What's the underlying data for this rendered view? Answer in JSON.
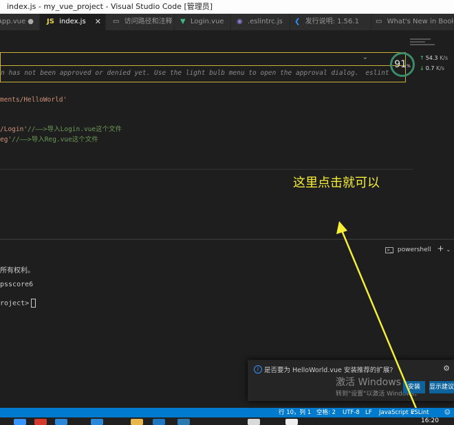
{
  "window": {
    "title": "index.js - my_vue_project - Visual Studio Code [管理员]"
  },
  "tabs": [
    {
      "icon_text": "",
      "label": "App.vue",
      "modified": true
    },
    {
      "icon_text": "JS",
      "label": "index.js",
      "active": true
    },
    {
      "icon_text": "",
      "label": "访问路径和注释"
    },
    {
      "icon_text": "",
      "label": "Login.vue"
    },
    {
      "icon_text": "",
      "label": ".eslintrc.js"
    },
    {
      "icon_text": "",
      "label": "发行说明: 1.56.1"
    },
    {
      "icon_text": "",
      "label": "What's New in Bookm"
    }
  ],
  "hover": {
    "message": "n has not been approved or denied yet. Use the light bulb menu to open the approval dialog.",
    "source": "eslint"
  },
  "editor": {
    "line1": "ments/HelloWorld'",
    "line2_str": "/Login'",
    "line2_cmt": "//——>导入Login.vue这个文件",
    "line3_str": "eg'",
    "line3_cmt": "//——>导入Reg.vue这个文件"
  },
  "annotation": "这里点击就可以",
  "widget": {
    "percent": "91",
    "percent_unit": "%",
    "upload": "54.3",
    "upload_unit": "K/s",
    "download": "0.7",
    "download_unit": "K/s"
  },
  "terminal": {
    "shell": "powershell",
    "line1": "所有权利。",
    "line2": "psscore6",
    "line3": "roject>"
  },
  "notification": {
    "text": "是否要为 HelloWorld.vue 安装推荐的扩展?",
    "install_label": "安装",
    "show_label": "显示建议"
  },
  "watermark": {
    "line1": "激活 Windows",
    "line2": "转到\"设置\"以激活 Windows。"
  },
  "status": {
    "position": "行 10，列 1",
    "spaces": "空格: 2",
    "encoding": "UTF-8",
    "eol": "LF",
    "language": "JavaScript",
    "linter": "ESLint"
  },
  "clock": "16:20",
  "colors": {
    "accent": "#007acc",
    "annotation": "#f5ef38",
    "hover_border": "#c9b33a"
  }
}
